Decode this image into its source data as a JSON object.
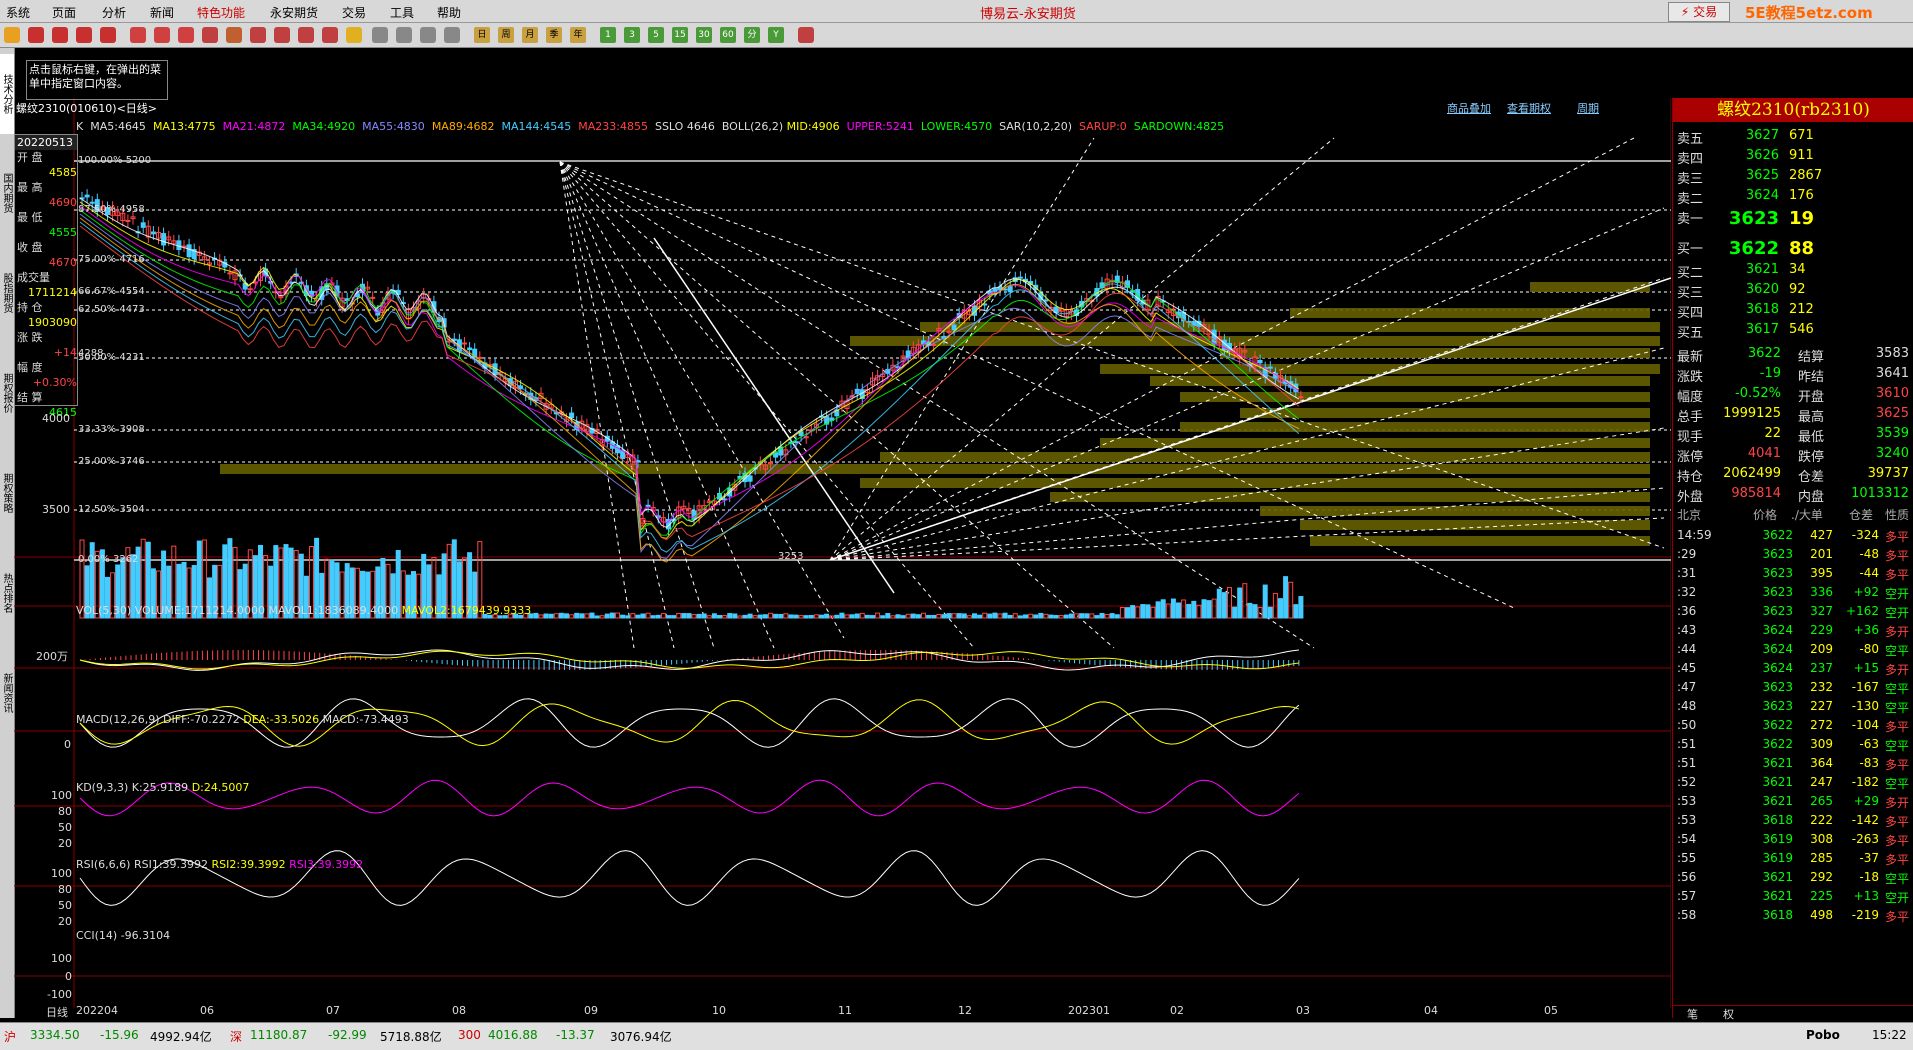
{
  "app": {
    "title": "博易云-永安期货",
    "trade_button": "交易",
    "logo_text": "5E教程5etz.com"
  },
  "menu": [
    "系统",
    "页面",
    "分析",
    "新闻",
    "特色功能",
    "永安期货",
    "交易",
    "工具",
    "帮助"
  ],
  "toolbar": {
    "period_buttons": [
      "1",
      "3",
      "5",
      "15",
      "30",
      "60",
      "分",
      "Y"
    ],
    "char_buttons": [
      "日",
      "周",
      "月",
      "季",
      "年"
    ]
  },
  "left_tabs": [
    "技术分析",
    "国内期货",
    "股指期货",
    "期权报价",
    "期权策略",
    "热点排名",
    "新闻资讯"
  ],
  "chart": {
    "tooltip": "点击鼠标右键，在弹出的菜单中指定窗口内容。",
    "symbol_line": "螺纹2310(010610)<日线>",
    "top_links": [
      "商品叠加",
      "查看期权",
      "周期"
    ],
    "ma_header": {
      "K": "K",
      "MA5": "MA5:4645",
      "MA13": "MA13:4775",
      "MA21": "MA21:4872",
      "MA34": "MA34:4920",
      "MA55": "MA55:4830",
      "MA89": "MA89:4682",
      "MA144": "MA144:4545",
      "MA233": "MA233:4855",
      "SSLO": "SSLO 4646",
      "BOLL": "BOLL(26,2)",
      "MID": "MID:4906",
      "UPPER": "UPPER:5241",
      "LOWER": "LOWER:4570",
      "SAR": "SAR(10,2,20)",
      "SARUP": "SARUP:0",
      "SARDOWN": "SARDOWN:4825"
    },
    "fib_levels": [
      {
        "label": "100.00%",
        "value": "5200"
      },
      {
        "label": "87.50%",
        "value": "4958"
      },
      {
        "label": "75.00%",
        "value": "4716"
      },
      {
        "label": "66.67%",
        "value": "4554"
      },
      {
        "label": "62.50%",
        "value": "4473"
      },
      {
        "label": "50.00%",
        "value": "4231"
      },
      {
        "label": "33.33%",
        "value": "3908"
      },
      {
        "label": "25.00%",
        "value": "3746"
      },
      {
        "label": "12.50%",
        "value": "3504"
      },
      {
        "label": "0.00%",
        "value": "3262"
      }
    ],
    "price_axis": [
      "4000",
      "3500"
    ],
    "y_axis_extra": "4288",
    "low_mark": "3253",
    "data_sheet": {
      "date": "20220513",
      "rows": [
        {
          "label": "开  盘",
          "value": "4585"
        },
        {
          "label": "最  高",
          "value": "4690"
        },
        {
          "label": "最  低",
          "value": "4555"
        },
        {
          "label": "收  盘",
          "value": "4670"
        },
        {
          "label": "成交量",
          "value": "1711214"
        },
        {
          "label": "持  仓",
          "value": "1903090"
        },
        {
          "label": "涨  跌",
          "value": "+14"
        },
        {
          "label": "幅  度",
          "value": "+0.30%"
        },
        {
          "label": "结  算",
          "value": "4615"
        }
      ]
    },
    "x_axis": [
      "日线",
      "202204",
      "06",
      "07",
      "08",
      "09",
      "10",
      "11",
      "12",
      "202301",
      "02",
      "03",
      "04",
      "05"
    ],
    "vol_panel": {
      "title": "VOL(5,30)",
      "volume": "VOLUME:1711214.0000",
      "mavol1": "MAVOL1:1836089.4000",
      "mavol2": "MAVOL2:1679439.9333",
      "axis": "200万"
    },
    "macd_panel": {
      "title": "MACD(12,26,9)",
      "diff": "DIFF:-70.2272",
      "dea": "DEA:-33.5026",
      "macd": "MACD:-73.4493",
      "axis": "0"
    },
    "kd_panel": {
      "title": "KD(9,3,3)",
      "k": "K:25.9189",
      "d": "D:24.5007",
      "axis": [
        "100",
        "80",
        "50",
        "20"
      ]
    },
    "rsi_panel": {
      "title": "RSI(6,6,6)",
      "rsi1": "RSI1:39.3992",
      "rsi2": "RSI2:39.3992",
      "rsi3": "RSI3:39.3992",
      "axis": [
        "100",
        "80",
        "50",
        "20"
      ]
    },
    "cci_panel": {
      "title": "CCI(14)",
      "value": "-96.3104",
      "axis": [
        "100",
        "0",
        "-100"
      ]
    }
  },
  "quote": {
    "title": "螺纹2310(rb2310)",
    "asks": [
      {
        "label": "卖五",
        "price": "3627",
        "vol": "671"
      },
      {
        "label": "卖四",
        "price": "3626",
        "vol": "911"
      },
      {
        "label": "卖三",
        "price": "3625",
        "vol": "2867"
      },
      {
        "label": "卖二",
        "price": "3624",
        "vol": "176"
      },
      {
        "label": "卖一",
        "price": "3623",
        "vol": "19"
      }
    ],
    "bids": [
      {
        "label": "买一",
        "price": "3622",
        "vol": "88"
      },
      {
        "label": "买二",
        "price": "3621",
        "vol": "34"
      },
      {
        "label": "买三",
        "price": "3620",
        "vol": "92"
      },
      {
        "label": "买四",
        "price": "3618",
        "vol": "212"
      },
      {
        "label": "买五",
        "price": "3617",
        "vol": "546"
      }
    ],
    "stats": [
      {
        "l1": "最新",
        "v1": "3622",
        "l2": "结算",
        "v2": "3583"
      },
      {
        "l1": "涨跌",
        "v1": "-19",
        "l2": "昨结",
        "v2": "3641"
      },
      {
        "l1": "幅度",
        "v1": "-0.52%",
        "l2": "开盘",
        "v2": "3610"
      },
      {
        "l1": "总手",
        "v1": "1999125",
        "l2": "最高",
        "v2": "3625"
      },
      {
        "l1": "现手",
        "v1": "22",
        "l2": "最低",
        "v2": "3539"
      },
      {
        "l1": "涨停",
        "v1": "4041",
        "l2": "跌停",
        "v2": "3240"
      },
      {
        "l1": "持仓",
        "v1": "2062499",
        "l2": "仓差",
        "v2": "39737"
      },
      {
        "l1": "外盘",
        "v1": "985814",
        "l2": "内盘",
        "v2": "1013312"
      }
    ],
    "tick_header": [
      "北京",
      "价格",
      "./大单",
      "仓差",
      "性质"
    ],
    "ticks": [
      {
        "t": "14:59",
        "p": "3622",
        "v": "427",
        "d": "-324",
        "n": "多平"
      },
      {
        "t": ":29",
        "p": "3623",
        "v": "201",
        "d": "-48",
        "n": "多平"
      },
      {
        "t": ":31",
        "p": "3623",
        "v": "395",
        "d": "-44",
        "n": "多平"
      },
      {
        "t": ":32",
        "p": "3623",
        "v": "336",
        "d": "+92",
        "n": "空开"
      },
      {
        "t": ":36",
        "p": "3623",
        "v": "327",
        "d": "+162",
        "n": "空开"
      },
      {
        "t": ":43",
        "p": "3624",
        "v": "229",
        "d": "+36",
        "n": "多开"
      },
      {
        "t": ":44",
        "p": "3624",
        "v": "209",
        "d": "-80",
        "n": "空平"
      },
      {
        "t": ":45",
        "p": "3624",
        "v": "237",
        "d": "+15",
        "n": "多开"
      },
      {
        "t": ":47",
        "p": "3623",
        "v": "232",
        "d": "-167",
        "n": "空平"
      },
      {
        "t": ":48",
        "p": "3623",
        "v": "227",
        "d": "-130",
        "n": "空平"
      },
      {
        "t": ":50",
        "p": "3622",
        "v": "272",
        "d": "-104",
        "n": "多平"
      },
      {
        "t": ":51",
        "p": "3622",
        "v": "309",
        "d": "-63",
        "n": "空平"
      },
      {
        "t": ":51",
        "p": "3621",
        "v": "364",
        "d": "-83",
        "n": "多平"
      },
      {
        "t": ":52",
        "p": "3621",
        "v": "247",
        "d": "-182",
        "n": "空平"
      },
      {
        "t": ":53",
        "p": "3621",
        "v": "265",
        "d": "+29",
        "n": "多开"
      },
      {
        "t": ":53",
        "p": "3618",
        "v": "222",
        "d": "-142",
        "n": "多平"
      },
      {
        "t": ":54",
        "p": "3619",
        "v": "308",
        "d": "-263",
        "n": "多平"
      },
      {
        "t": ":55",
        "p": "3619",
        "v": "285",
        "d": "-37",
        "n": "多平"
      },
      {
        "t": ":56",
        "p": "3621",
        "v": "292",
        "d": "-18",
        "n": "空平"
      },
      {
        "t": ":57",
        "p": "3621",
        "v": "225",
        "d": "+13",
        "n": "空开"
      },
      {
        "t": ":58",
        "p": "3618",
        "v": "498",
        "d": "-219",
        "n": "多平"
      }
    ],
    "bottom_tabs": [
      "笔",
      "权"
    ]
  },
  "statusbar": {
    "items": [
      {
        "label": "沪",
        "price": "3334.50",
        "change": "-15.96",
        "amount": "4992.94亿"
      },
      {
        "label": "深",
        "price": "11180.87",
        "change": "-92.99",
        "amount": "5718.88亿"
      },
      {
        "label": "300",
        "price": "4016.88",
        "change": "-13.37",
        "amount": "3076.94亿"
      }
    ],
    "right": [
      "Pobo",
      "15:22"
    ]
  }
}
